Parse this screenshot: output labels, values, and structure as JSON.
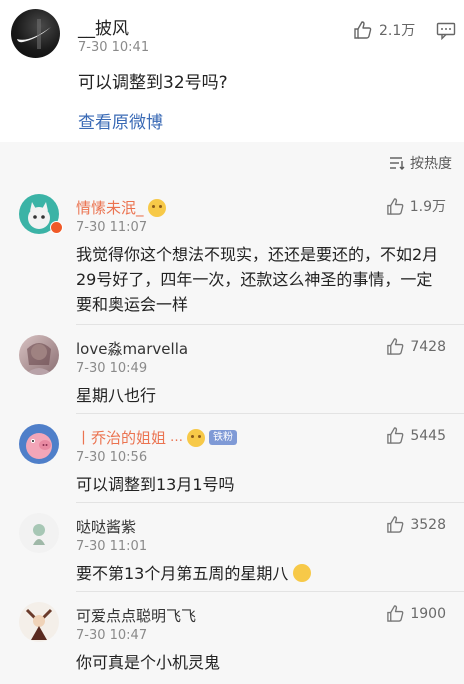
{
  "post": {
    "username": "__披风",
    "time": "7-30 10:41",
    "content": "可以调整到32号吗?",
    "view_original": "查看原微博",
    "likes": "2.1万"
  },
  "sort": {
    "label": "按热度"
  },
  "comments": [
    {
      "name": "情愫未泯_",
      "time": "7-30 11:07",
      "text": "我觉得你这个想法不现实，还还是要还的，不如2月29号好了，四年一次，还款这么神圣的事情，一定要和奥运会一样",
      "likes": "1.9万"
    },
    {
      "name": "love淼marvella",
      "time": "7-30 10:49",
      "text": "星期八也行",
      "likes": "7428"
    },
    {
      "name": "丨乔治的姐姐",
      "badge": "铁粉",
      "time": "7-30 10:56",
      "text": "可以调整到13月1号吗",
      "likes": "5445"
    },
    {
      "name": "哒哒酱紫",
      "time": "7-30 11:01",
      "text": "要不第13个月第五周的星期八",
      "likes": "3528"
    },
    {
      "name": "可爱点点聪明飞飞",
      "time": "7-30 10:47",
      "text": "你可真是个小机灵鬼",
      "likes": "1900"
    }
  ],
  "colors": {
    "link": "#3a6ab5",
    "orange_name": "#eb7350",
    "background": "#f7f7f7"
  }
}
